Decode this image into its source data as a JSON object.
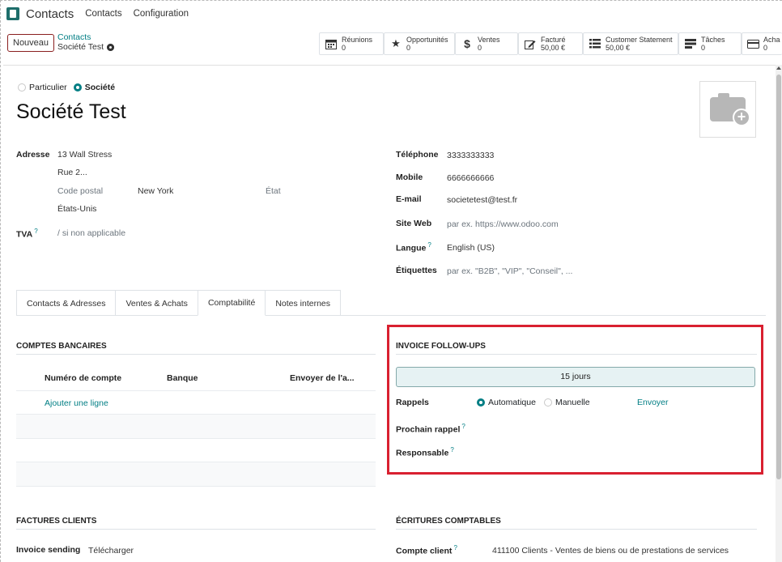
{
  "nav": {
    "app_title": "Contacts",
    "menu": [
      "Contacts",
      "Configuration"
    ]
  },
  "control": {
    "new_button": "Nouveau",
    "breadcrumb_parent": "Contacts",
    "breadcrumb_current": "Société Test"
  },
  "stats": [
    {
      "icon": "calendar-icon",
      "label": "Réunions",
      "value": "0"
    },
    {
      "icon": "star-icon",
      "label": "Opportunités",
      "value": "0"
    },
    {
      "icon": "dollar-icon",
      "label": "Ventes",
      "value": "0"
    },
    {
      "icon": "invoice-edit-icon",
      "label": "Facturé",
      "value": "50,00 €"
    },
    {
      "icon": "list-icon",
      "label": "Customer Statement",
      "value": "50,00 €"
    },
    {
      "icon": "tasks-icon",
      "label": "Tâches",
      "value": "0"
    },
    {
      "icon": "credit-card-icon",
      "label": "Acha",
      "value": "0"
    }
  ],
  "company_type": {
    "individual": "Particulier",
    "company": "Société",
    "selected": "company"
  },
  "record": {
    "name": "Société Test"
  },
  "address": {
    "label": "Adresse",
    "street": "13 Wall Stress",
    "street2": "Rue 2...",
    "zip_placeholder": "Code postal",
    "city": "New York",
    "state_placeholder": "État",
    "country": "États-Unis"
  },
  "vat": {
    "label": "TVA",
    "placeholder": "/ si non applicable",
    "help": "?"
  },
  "contact_info": {
    "phone_label": "Téléphone",
    "phone": "3333333333",
    "mobile_label": "Mobile",
    "mobile": "6666666666",
    "email_label": "E-mail",
    "email": "societetest@test.fr",
    "website_label": "Site Web",
    "website_placeholder": "par ex. https://www.odoo.com",
    "lang_label": "Langue",
    "lang": "English (US)",
    "tags_label": "Étiquettes",
    "tags_placeholder": "par ex. \"B2B\", \"VIP\", \"Conseil\", ..."
  },
  "tabs": [
    {
      "label": "Contacts & Adresses",
      "active": false
    },
    {
      "label": "Ventes & Achats",
      "active": false
    },
    {
      "label": "Comptabilité",
      "active": true
    },
    {
      "label": "Notes internes",
      "active": false
    }
  ],
  "bank": {
    "title": "COMPTES BANCAIRES",
    "columns": [
      "Numéro de compte",
      "Banque",
      "Envoyer de l'a..."
    ],
    "add_line": "Ajouter une ligne"
  },
  "followup": {
    "title": "INVOICE FOLLOW-UPS",
    "due": "15 jours",
    "reminders_label": "Rappels",
    "auto": "Automatique",
    "manual": "Manuelle",
    "send": "Envoyer",
    "next_label": "Prochain rappel",
    "responsible_label": "Responsable",
    "help": "?"
  },
  "invoices": {
    "title": "FACTURES CLIENTS",
    "sending_label": "Invoice sending",
    "sending_value": "Télécharger"
  },
  "journal": {
    "title": "ÉCRITURES COMPTABLES",
    "account_label": "Compte client",
    "account_value": "411100 Clients - Ventes de biens ou de prestations de services"
  },
  "colors": {
    "accent": "#017e84",
    "highlight": "#d92030"
  }
}
